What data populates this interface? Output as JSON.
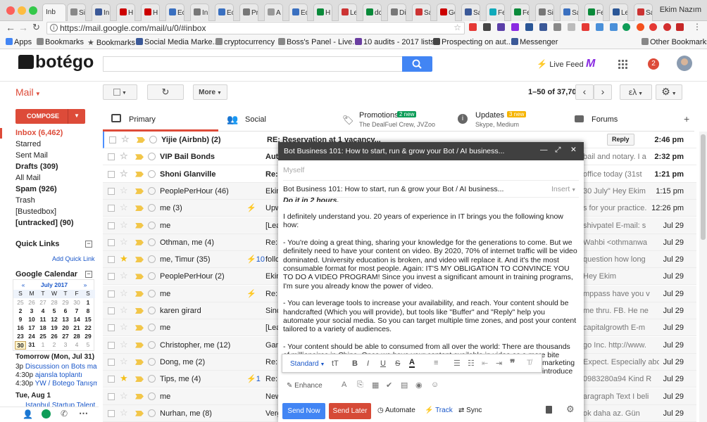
{
  "browser": {
    "tabs": [
      "Inb",
      "Si",
      "In",
      "H",
      "H",
      "Ec",
      "In",
      "Ec",
      "Pr",
      "A",
      "Ec",
      "H",
      "Le",
      "dc",
      "Di",
      "Sa",
      "Ge",
      "Sa",
      "Fe",
      "Fe",
      "Si",
      "Sa",
      "Fe",
      "Le",
      "Sa"
    ],
    "profile_name": "Ekim Nazım",
    "url": "https://mail.google.com/mail/u/0/#inbox",
    "bookmarks": [
      "Apps",
      "Bookmarks",
      "Bookmarks",
      "Social Media Marke...",
      "cryptocurrency",
      "Boss's Panel - Live...",
      "10 audits - 2017 lists",
      "Prospecting on aut...",
      "Messenger",
      "Other Bookmarks"
    ]
  },
  "header": {
    "logo_text": "botégo",
    "live_feed": "Live Feed",
    "notif_count": "2"
  },
  "toolbar": {
    "mail_label": "Mail",
    "more_label": "More",
    "range": "1–50 of 37,700",
    "lang_label": "ελ"
  },
  "sidebar": {
    "compose": "COMPOSE",
    "items": [
      {
        "label": "Inbox (6,462)"
      },
      {
        "label": "Starred"
      },
      {
        "label": "Sent Mail"
      },
      {
        "label": "Drafts (309)"
      },
      {
        "label": "All Mail"
      },
      {
        "label": "Spam (926)"
      },
      {
        "label": "Trash"
      },
      {
        "label": "[Bustedbox]"
      },
      {
        "label": "[untracked] (90)"
      }
    ],
    "quick_links": "Quick Links",
    "add_quick_link": "Add Quick Link",
    "google_calendar": "Google Calendar",
    "calendar": {
      "month": "July 2017",
      "prev": "«",
      "next": "»",
      "weekdays": [
        "S",
        "M",
        "T",
        "W",
        "T",
        "F",
        "S"
      ],
      "weeks": [
        [
          "25",
          "26",
          "27",
          "28",
          "29",
          "30",
          "1"
        ],
        [
          "2",
          "3",
          "4",
          "5",
          "6",
          "7",
          "8"
        ],
        [
          "9",
          "10",
          "11",
          "12",
          "13",
          "14",
          "15"
        ],
        [
          "16",
          "17",
          "18",
          "19",
          "20",
          "21",
          "22"
        ],
        [
          "23",
          "24",
          "25",
          "26",
          "27",
          "28",
          "29"
        ],
        [
          "30",
          "31",
          "1",
          "2",
          "3",
          "4",
          "5"
        ]
      ]
    },
    "agenda": {
      "tomorrow": "Tomorrow (Mon, Jul 31)",
      "events": [
        {
          "time": "3p",
          "title": "Discussion on Bots mai"
        },
        {
          "time": "4:30p",
          "title": "ajansla toplantı"
        },
        {
          "time": "4:30p",
          "title": "YW / Botego Tanışm"
        }
      ],
      "next_day": "Tue, Aug 1",
      "next_event": "İstanbul Startup Talent"
    }
  },
  "categories": [
    {
      "label": "Primary",
      "sub": ""
    },
    {
      "label": "Social",
      "sub": ""
    },
    {
      "label": "Promotions",
      "badge": "2 new",
      "sub": "The DealFuel Crew, JVZoo"
    },
    {
      "label": "Updates",
      "badge": "3 new",
      "sub": "Skype, Medium"
    },
    {
      "label": "Forums",
      "sub": ""
    }
  ],
  "emails": [
    {
      "sender": "Yijie (Airbnb) (2)",
      "subject": "RE: Reservation at 1 vacancy...",
      "tail": "Reply",
      "date": "2:46 pm",
      "star": false,
      "imp": true,
      "unread": true
    },
    {
      "sender": "VIP Bail Bonds",
      "subject": "Auto",
      "tail": "bail and notary. I a",
      "date": "2:32 pm",
      "star": false,
      "imp": true,
      "unread": true
    },
    {
      "sender": "Shoni Glanville",
      "subject": "Re:",
      "tail": "office today (31st",
      "date": "1:21 pm",
      "star": false,
      "imp": true,
      "unread": true
    },
    {
      "sender": "PeoplePerHour (46)",
      "subject": "Ekim",
      "tail": "30 July\" Hey Ekim",
      "date": "1:15 pm",
      "star": false,
      "imp": true,
      "unread": false
    },
    {
      "sender": "me (3)",
      "subject": "Upw",
      "tail": "s for your practice.",
      "date": "12:26 pm",
      "star": false,
      "imp": true,
      "unread": false,
      "bolt": "⚡"
    },
    {
      "sender": "me",
      "subject": "[Lea",
      "tail": "shivpatel E-mail: s",
      "date": "Jul 29",
      "star": false,
      "imp": true,
      "unread": false
    },
    {
      "sender": "Othman, me (4)",
      "subject": "Re:",
      "tail": "Wahbi <othmanwa",
      "date": "Jul 29",
      "star": false,
      "imp": true,
      "unread": false
    },
    {
      "sender": "me, Timur (35)",
      "subject": "follo",
      "tail": "question how long",
      "date": "Jul 29",
      "star": true,
      "imp": true,
      "unread": false,
      "bolt": "⚡10"
    },
    {
      "sender": "PeoplePerHour (2)",
      "subject": "Ekim",
      "tail": "Hey Ekim",
      "date": "Jul 29",
      "star": false,
      "imp": true,
      "unread": false
    },
    {
      "sender": "me",
      "subject": "Re:",
      "tail": "mppass have you v",
      "date": "Jul 29",
      "star": false,
      "imp": true,
      "unread": false,
      "bolt": "⚡"
    },
    {
      "sender": "karen girard",
      "subject": "Sinc",
      "tail": "me thru. FB. He ne",
      "date": "Jul 29",
      "star": false,
      "imp": true,
      "unread": false
    },
    {
      "sender": "me",
      "subject": "[Lea",
      "tail": "capitalgrowth E-m",
      "date": "Jul 29",
      "star": false,
      "imp": true,
      "unread": false
    },
    {
      "sender": "Christopher, me (12)",
      "subject": "Gam",
      "tail": "go Inc. http://www.",
      "date": "Jul 29",
      "star": false,
      "imp": true,
      "unread": false
    },
    {
      "sender": "Dong, me (2)",
      "subject": "Re:",
      "tail": "Expect. Especially about",
      "date": "Jul 29",
      "star": false,
      "imp": true,
      "unread": false
    },
    {
      "sender": "Tips, me (4)",
      "subject": "Re:",
      "tail": "0983280a94 Kind R",
      "date": "Jul 29",
      "star": true,
      "imp": true,
      "unread": false,
      "bolt": "⚡1"
    },
    {
      "sender": "me",
      "subject": "New",
      "tail": "aragraph Text I beli",
      "date": "Jul 29",
      "star": false,
      "imp": true,
      "unread": false
    },
    {
      "sender": "Nurhan, me (8)",
      "subject": "Verg",
      "tail": "ok daha az. Gün",
      "date": "Jul 29",
      "star": false,
      "imp": true,
      "unread": false
    }
  ],
  "composer": {
    "title": "Bot Business 101: How to start, run & grow your Bot / AI business...",
    "from_placeholder": "Myself",
    "subject": "Bot Business 101: How to start, run & grow your Bot / AI business...",
    "insert": "Insert",
    "partial_line": "Do it in 2 hours.",
    "paragraphs": [
      "I definitely understand you. 20 years of experience in IT brings you the following know how:",
      "- You're doing a great thing, sharing your knowledge for the generations to come. But we definitely need to have your content on video. By 2020, 70% of internet traffic will be video dominated. University education is broken, and video will replace it. And it's the most consumable format for most people. Again: IT'S MY OBLIGATION TO CONVINCE YOU TO DO A VIDEO PROGRAM! Since you invest a significant amount in training programs, I'm sure you already know the power of video.",
      "- You can leverage tools to increase your availability, and reach. Your content should be handcrafted (Which you will provide), but tools like \"Buffer\" and \"Reply\" help you automate your social media. So you can target multiple time zones, and post your content tailored to a variety of audiences.",
      "- Your content should be able to consumed from all over the world: There are thousands of millionaires in China. Once we have your content available in video as a more bite sized version, we will use rev.com to transcribe them in multiple languages."
    ],
    "overflow_1": "marketing",
    "overflow_2": "introduce",
    "format_style": "Standard",
    "enhance": "Enhance",
    "send_now": "Send Now",
    "send_later": "Send Later",
    "automate": "Automate",
    "track": "Track",
    "sync": "Sync"
  },
  "colors": {
    "compose_red": "#dd4b39",
    "send_blue": "#4285f4",
    "send_later_red": "#d64a37",
    "active_tab": "#dd4b39",
    "badge_green": "#0d9d58",
    "badge_yellow": "#f6b400"
  }
}
